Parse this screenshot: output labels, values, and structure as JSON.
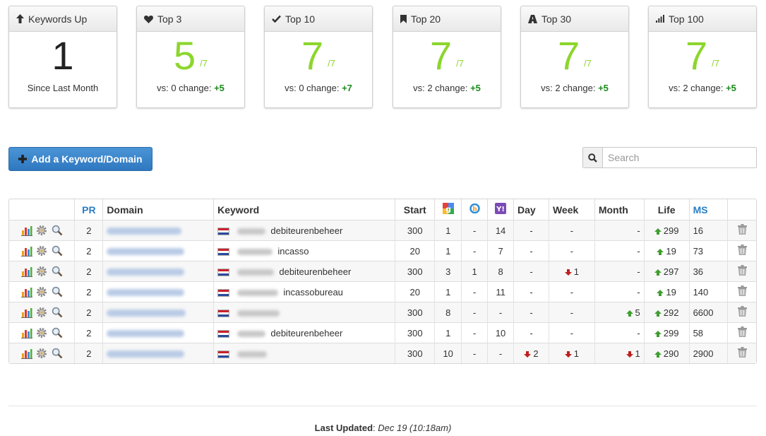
{
  "cards": [
    {
      "title": "Keywords Up",
      "icon": "arrow-up-icon",
      "value": "1",
      "of": "",
      "footer_text": "Since Last Month",
      "change": ""
    },
    {
      "title": "Top 3",
      "icon": "heart-icon",
      "value": "5",
      "of": "/7",
      "footer_text": "vs: 0 change: ",
      "change": "+5"
    },
    {
      "title": "Top 10",
      "icon": "checkmark-icon",
      "value": "7",
      "of": "/7",
      "footer_text": "vs: 0 change: ",
      "change": "+7"
    },
    {
      "title": "Top 20",
      "icon": "bookmark-icon",
      "value": "7",
      "of": "/7",
      "footer_text": "vs: 2 change: ",
      "change": "+5"
    },
    {
      "title": "Top 30",
      "icon": "road-icon",
      "value": "7",
      "of": "/7",
      "footer_text": "vs: 2 change: ",
      "change": "+5"
    },
    {
      "title": "Top 100",
      "icon": "signal-bars-icon",
      "value": "7",
      "of": "/7",
      "footer_text": "vs: 2 change: ",
      "change": "+5"
    }
  ],
  "add_button_label": "Add a Keyword/Domain",
  "search": {
    "placeholder": "Search",
    "value": ""
  },
  "table": {
    "headers": {
      "pr": "PR",
      "domain": "Domain",
      "keyword": "Keyword",
      "start": "Start",
      "day": "Day",
      "week": "Week",
      "month": "Month",
      "life": "Life",
      "ms": "MS"
    },
    "rows": [
      {
        "pr": "2",
        "keyword": "debiteurenbeheer",
        "start": "300",
        "google": "1",
        "bing": "-",
        "yahoo": "14",
        "day": "-",
        "week": "-",
        "month": "-",
        "life": "299",
        "ms": "16"
      },
      {
        "pr": "2",
        "keyword": "incasso",
        "start": "20",
        "google": "1",
        "bing": "-",
        "yahoo": "7",
        "day": "-",
        "week": "-",
        "month": "-",
        "life": "19",
        "ms": "73"
      },
      {
        "pr": "2",
        "keyword": "debiteurenbeheer",
        "start": "300",
        "google": "3",
        "bing": "1",
        "yahoo": "8",
        "day": "-",
        "week": "1",
        "month": "-",
        "life": "297",
        "ms": "36"
      },
      {
        "pr": "2",
        "keyword": "incassobureau",
        "start": "20",
        "google": "1",
        "bing": "-",
        "yahoo": "11",
        "day": "-",
        "week": "-",
        "month": "-",
        "life": "19",
        "ms": "140"
      },
      {
        "pr": "2",
        "keyword": "",
        "start": "300",
        "google": "8",
        "bing": "-",
        "yahoo": "-",
        "day": "-",
        "week": "-",
        "month": "5",
        "life": "292",
        "ms": "6600"
      },
      {
        "pr": "2",
        "keyword": "debiteurenbeheer",
        "start": "300",
        "google": "1",
        "bing": "-",
        "yahoo": "10",
        "day": "-",
        "week": "-",
        "month": "-",
        "life": "299",
        "ms": "58"
      },
      {
        "pr": "2",
        "keyword": "",
        "start": "300",
        "google": "10",
        "bing": "-",
        "yahoo": "-",
        "day": "2",
        "week": "1",
        "month": "1",
        "life": "290",
        "ms": "2900"
      }
    ]
  },
  "footer": {
    "label": "Last Updated",
    "value": "Dec 19 (10:18am)"
  },
  "colors": {
    "accent_green": "#8dd62e",
    "change_green": "#1a8a1a",
    "button_blue": "#3a86cc",
    "down_red": "#c0201e"
  }
}
